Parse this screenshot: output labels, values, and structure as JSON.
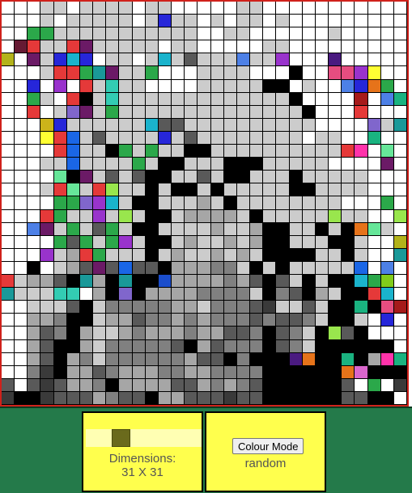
{
  "controls": {
    "dimensions_label": "Dimensions:",
    "dimensions_value": "31 X 31",
    "grid_size": 31,
    "slider_fraction": 0.27,
    "colour_mode_button": "Colour Mode",
    "colour_mode_value": "random"
  },
  "colors": {
    "frame": "#d0211b",
    "footer": "#247a4a",
    "panel": "#ffff4d",
    "slider_track": "#ffffb3",
    "slider_thumb": "#6a6a1c"
  },
  "grid": {
    "palette": {
      ".": "#ffffff",
      "K": "#000000",
      "g": "#cccccc",
      "h": "#a6a6a6",
      "m": "#808080",
      "d": "#595959",
      "e": "#3a3a3a",
      "1": "#e53939",
      "2": "#2ba84a",
      "3": "#2626d9",
      "4": "#9933cc",
      "5": "#1a9999",
      "6": "#d966cc",
      "7": "#b3b31a",
      "8": "#66e699",
      "9": "#4d80e6",
      "a": "#e6731a",
      "b": "#6b1a66",
      "c": "#1ab3cc",
      "f": "#ffff33",
      "i": "#4a1a80",
      "j": "#99e64d",
      "k": "#a61a1a",
      "l": "#ff33aa",
      "n": "#1a66e6",
      "o": "#8066cc",
      "p": "#ccb31a",
      "q": "#1ab380",
      "r": "#1a4dcc",
      "s": "#661a33",
      "t": "#33ccb3",
      "u": "#e64d80",
      "v": "#80cc1a"
    },
    "rows": [
      "...gg.gggg.gg.....gg...........",
      "...g.ggggg.g3gg.g.gg.g.........",
      "..22ggggggggggg..gg......g.....",
      ".s1gg1bggggg.gg.....gg.........",
      "7.bg3c3.gg.gcgdggg9gg4...i.....",
      "...g1125bgg2...gggg...K..uu4f..",
      "..3.4.1gtgg....gggggKK.g..93a2.",
      "..2g.1KgtgggggggggggggK....k.9q",
      "..1.gobg2ggggggggggggggK...1...",
      "...p3ggggggcddgggggggggg....og5",
      "...f1ngdgggg3gdgggggggg.gg..q..",
      "....1nggK2g2ggKKgggggggggg1l.8.",
      "...ggngggg2gKKgggKKKggggg....b.",
      "....8KbgdgdKKggdgKKgggKggggg...",
      "...g18g1jggKgKKgKgggggKKgggg...",
      "....22o4cgKKggghgKgggggggg...2.",
      "...12gg4gjgKKghhhhgKgggggjgg..j",
      "..9bg2gd2gKKgggghgghKKggKgKa8g.",
      "....2d2g24gKKghgghghKKgggKKg..7",
      "...4gh12gggKghgghghgKKKKggKg..5",
      "..K.ghdbdnddKhhhmmgKgKgggggn.9.",
      "1ghhdK5hK5KKrhhhhmhdKdgKgKKc2v.",
      "5gggtt.hKoKhhhhmmmmgKmdKhgKK1c.",
      "..gggdKgmmmmmhhgmmmdeggdgKKqKuk",
      "..hhmKKghhdmmhmhmmmdmddmgKKg.3.",
      "..hdmKhgghmhhhmhhddmKdmgKjdK...",
      "..hdKKhgmmmmmdKhdmmmKdmgKKKKKK.",
      "..hdKhmgmmmmmmhddKmKKKiaKKqKhlq",
      "..meKhhdmhhhmmhhmmmmKKKKKKa6KKK",
      "d.dedhhmKhhhhddhmhmdKKKKKKd.2.e",
      "eKKedddhmddKhhdddeddKKKKKKddKK."
    ]
  }
}
